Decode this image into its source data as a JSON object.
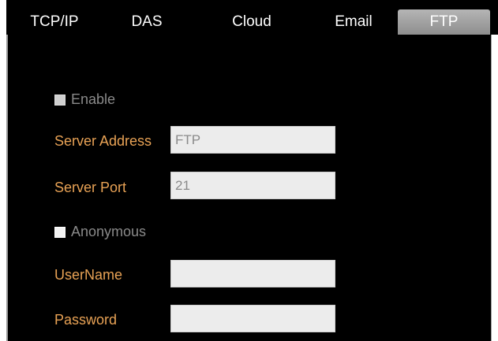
{
  "tabs": [
    {
      "label": "TCP/IP"
    },
    {
      "label": "DAS"
    },
    {
      "label": "Cloud"
    },
    {
      "label": "Email"
    },
    {
      "label": "FTP",
      "active": true
    }
  ],
  "form": {
    "enable_label": "Enable",
    "server_address_label": "Server Address",
    "server_address_value": "FTP",
    "server_port_label": "Server Port",
    "server_port_value": "21",
    "anonymous_label": "Anonymous",
    "username_label": "UserName",
    "username_value": "",
    "password_label": "Password",
    "password_value": ""
  },
  "colors": {
    "background": "#000000",
    "label_accent": "#e8a255",
    "disabled_text": "#8a8a8a",
    "active_tab": "#a3a3a3",
    "input_bg": "#ececec"
  }
}
